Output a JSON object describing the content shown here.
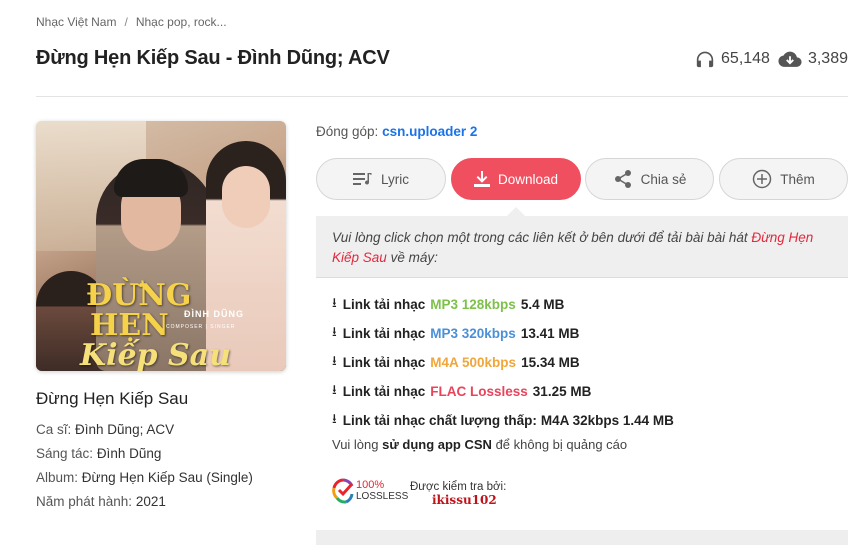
{
  "breadcrumb": {
    "item1": "Nhạc Việt Nam",
    "separator": "/",
    "item2": "Nhạc pop, rock..."
  },
  "title": "Đừng Hẹn Kiếp Sau - Đình Dũng; ACV",
  "stats": {
    "listens": "65,148",
    "downloads": "3,389",
    "listen_icon": "headphones-icon",
    "download_icon": "cloud-download-icon"
  },
  "cover": {
    "art_title_line1": "ĐỪNG",
    "art_title_line2": "HẸN",
    "art_title_line3": "Kiếp Sau",
    "art_artist": "ĐÌNH DŨNG",
    "art_artist_sub": "COMPOSER | SINGER"
  },
  "song": {
    "name": "Đừng Hẹn Kiếp Sau",
    "singer_label": "Ca sĩ:",
    "singer": "Đình Dũng; ACV",
    "composer_label": "Sáng tác:",
    "composer": "Đình Dũng",
    "album_label": "Album:",
    "album": "Đừng Hẹn Kiếp Sau (Single)",
    "year_label": "Năm phát hành:",
    "year": "2021"
  },
  "contributor": {
    "label": "Đóng góp:",
    "user": "csn.uploader 2"
  },
  "actions": {
    "lyric": "Lyric",
    "download": "Download",
    "share": "Chia sẻ",
    "more": "Thêm"
  },
  "download_note": {
    "text": "Vui lòng click chọn một trong các liên kết ở bên dưới để tải bài bài hát",
    "song": "Đừng Hẹn Kiếp Sau",
    "suffix": "về máy:"
  },
  "links": [
    {
      "prefix": "Link tải nhạc",
      "format": "MP3 128kbps",
      "size": "5.4 MB"
    },
    {
      "prefix": "Link tải nhạc",
      "format": "MP3 320kbps",
      "size": "13.41 MB"
    },
    {
      "prefix": "Link tải nhạc",
      "format": "M4A 500kbps",
      "size": "15.34 MB"
    },
    {
      "prefix": "Link tải nhạc",
      "format": "FLAC Lossless",
      "size": "31.25 MB"
    },
    {
      "prefix": "Link tải nhạc chất lượng thấp:",
      "format": "",
      "size": "M4A 32kbps 1.44 MB"
    }
  ],
  "app_note": {
    "pre": "Vui lòng",
    "bold": "sử dụng app CSN",
    "post": "để không bị quảng cáo"
  },
  "lossless_badge": {
    "pct": "100%",
    "label": "LOSSLESS"
  },
  "checked_by": {
    "label": "Được kiểm tra bởi:",
    "user": "ikissu102"
  },
  "colors": {
    "accent": "#ef4f5f",
    "link_blue": "#1a73e8",
    "mp3_128": "#7dc04b",
    "mp3_320": "#4a90d9",
    "m4a": "#f0a63a",
    "flac": "#e8445b"
  }
}
